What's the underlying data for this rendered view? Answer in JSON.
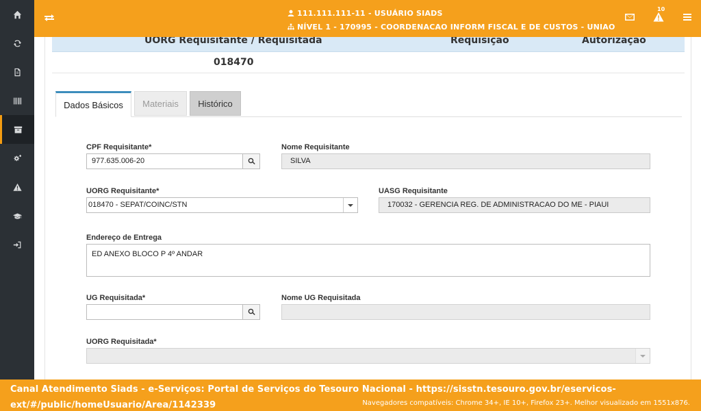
{
  "sidebar": {
    "items": [
      {
        "icon": "home-icon"
      },
      {
        "icon": "refresh-icon"
      },
      {
        "icon": "document-icon"
      },
      {
        "icon": "barcode-icon"
      },
      {
        "icon": "archive-icon"
      },
      {
        "icon": "cogs-icon"
      },
      {
        "icon": "warning-icon"
      },
      {
        "icon": "graduation-cap-icon"
      },
      {
        "icon": "sign-in-icon"
      }
    ],
    "active_index": 4
  },
  "header": {
    "user_line": "111.111.111-11 - USUÁRIO SIADS",
    "level_line": "NÍVEL 1 - 170995 - COORDENACAO INFORM FISCAL E DE CUSTOS - UNIAO",
    "alert_count": "10"
  },
  "table": {
    "headers": {
      "uorg": "UORG Requisitante / Requisitada",
      "requisicao": "Requisição",
      "autorizacao": "Autorização"
    },
    "row": {
      "uorg": "018470"
    }
  },
  "tabs": {
    "basic": "Dados Básicos",
    "materials": "Materiais",
    "history": "Histórico"
  },
  "form": {
    "cpf_label": "CPF Requisitante*",
    "cpf_value": "977.635.006-20",
    "nome_label": "Nome Requisitante",
    "nome_value": "SILVA",
    "uorg_label": "UORG Requisitante*",
    "uorg_value": "018470 - SEPAT/COINC/STN",
    "uasg_label": "UASG Requisitante",
    "uasg_value": "170032 - GERENCIA REG. DE ADMINISTRACAO DO ME - PIAUI",
    "endereco_label": "Endereço de Entrega",
    "endereco_value": "ED ANEXO BLOCO P 4º ANDAR",
    "ug_label": "UG Requisitada*",
    "ug_value": "",
    "nome_ug_label": "Nome UG Requisitada",
    "nome_ug_value": "",
    "uorg_req_label": "UORG Requisitada*",
    "uorg_req_value": ""
  },
  "footer": {
    "main_text": "Canal Atendimento Siads - e-Serviços: Portal de Serviços do Tesouro Nacional - https://sisstn.tesouro.gov.br/eservicos-ext/#/public/homeUsuario/Area/1142339",
    "compat_text": "Navegadores compatíveis: Chrome 34+, IE 10+, Firefox 23+. Melhor visualizado em 1551x876."
  },
  "colors": {
    "accent": "#f5a01c",
    "sidebar": "#2b3035",
    "table_header": "#d9e9f6",
    "tab_active_border": "#3c8dbc"
  }
}
